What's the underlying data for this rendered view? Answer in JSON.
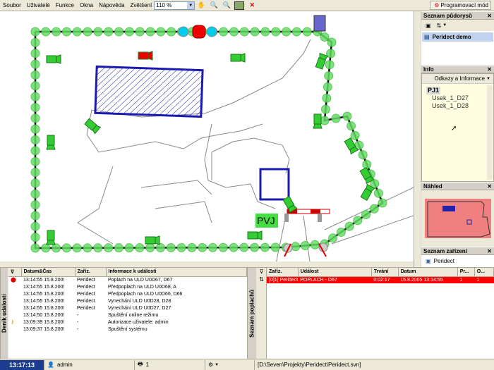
{
  "menu": [
    "Soubor",
    "Uživatelé",
    "Funkce",
    "Okna",
    "Nápověda"
  ],
  "zoom": {
    "label": "Zvětšení",
    "value": "110 %"
  },
  "toolbar": {
    "prog_mode": "Programovací mód"
  },
  "map": {
    "pvj_label": "PVJ"
  },
  "panels": {
    "plans": {
      "title": "Seznam půdorysů",
      "item": "Peridect demo"
    },
    "info": {
      "title": "Info",
      "select": "Odkazy a Informace",
      "root": "PJ1",
      "leaves": [
        "Usek_1_D27",
        "Usek_1_D28"
      ]
    },
    "preview": {
      "title": "Náhled"
    },
    "devices": {
      "title": "Seznam zařízení",
      "item": "Peridect"
    }
  },
  "events": {
    "tab": "Deník událostí",
    "headers": [
      "Datum&Čas",
      "Zaříz.",
      "Informace k události"
    ],
    "rows": [
      {
        "time": "13:14:55 15.8.200!",
        "dev": "Peridect",
        "info": "Poplach na ULD U0D67, D67",
        "icon": "alarm"
      },
      {
        "time": "13:14:55 15.8.200!",
        "dev": "Peridect",
        "info": "Předpoplach na ULD U0D68, A",
        "icon": ""
      },
      {
        "time": "13:14:55 15.8.200!",
        "dev": "Peridect",
        "info": "Předpoplach na ULD U0D66, D66",
        "icon": ""
      },
      {
        "time": "13:14:55 15.8.200!",
        "dev": "Peridect",
        "info": "Vynechání ULD U0D28, D28",
        "icon": ""
      },
      {
        "time": "13:14:55 15.8.200!",
        "dev": "Peridect",
        "info": "Vynechání ULD U0D27, D27",
        "icon": ""
      },
      {
        "time": "13:14:50 15.8.200!",
        "dev": "-",
        "info": "Spuštění online režimu",
        "icon": ""
      },
      {
        "time": "13:09:39 15.8.200!",
        "dev": "-",
        "info": "Autorizace uživatele: admin",
        "icon": "key"
      },
      {
        "time": "13:09:37 15.8.200!",
        "dev": "-",
        "info": "Spuštění systému",
        "icon": ""
      }
    ]
  },
  "alarms": {
    "tab": "Seznam poplachů",
    "headers": [
      "Zaříz.",
      "Událost",
      "Trvání",
      "Datum",
      "Pr...",
      "O..."
    ],
    "rows": [
      {
        "dev": "[0]1] Peridect",
        "event": "POPLACH - D67",
        "dur": "0:02:17",
        "date": "15.8.2005 13:14:55",
        "p": "1",
        "o": "1"
      }
    ]
  },
  "status": {
    "time": "13:17:13",
    "user": "admin",
    "count": "1",
    "path": "[D:\\Seven\\Projekty\\Peridect\\Peridect.svn]"
  },
  "colors": {
    "alarm_red": "#ff0000",
    "sensor_green": "#44dd44",
    "building_blue": "#1a1ab0",
    "time_bg": "#1c3d8f"
  }
}
